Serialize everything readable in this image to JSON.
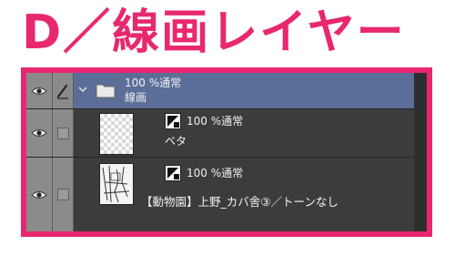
{
  "heading": "D／線画レイヤー",
  "colors": {
    "accent": "#e8286e",
    "panel": "#3c3c3c",
    "selected_row": "#5a6e98"
  },
  "layers": [
    {
      "opacity_blend": "100 %通常",
      "name": "線画",
      "type": "folder",
      "icon": "folder-icon",
      "selected": true
    },
    {
      "opacity_blend": "100 %通常",
      "name": "ベタ",
      "type": "raster",
      "icon": "layer-mask-icon"
    },
    {
      "opacity_blend": "100 %通常",
      "name": "【動物園】上野_カバ舎③／トーンなし",
      "type": "raster",
      "icon": "layer-mask-icon"
    }
  ]
}
